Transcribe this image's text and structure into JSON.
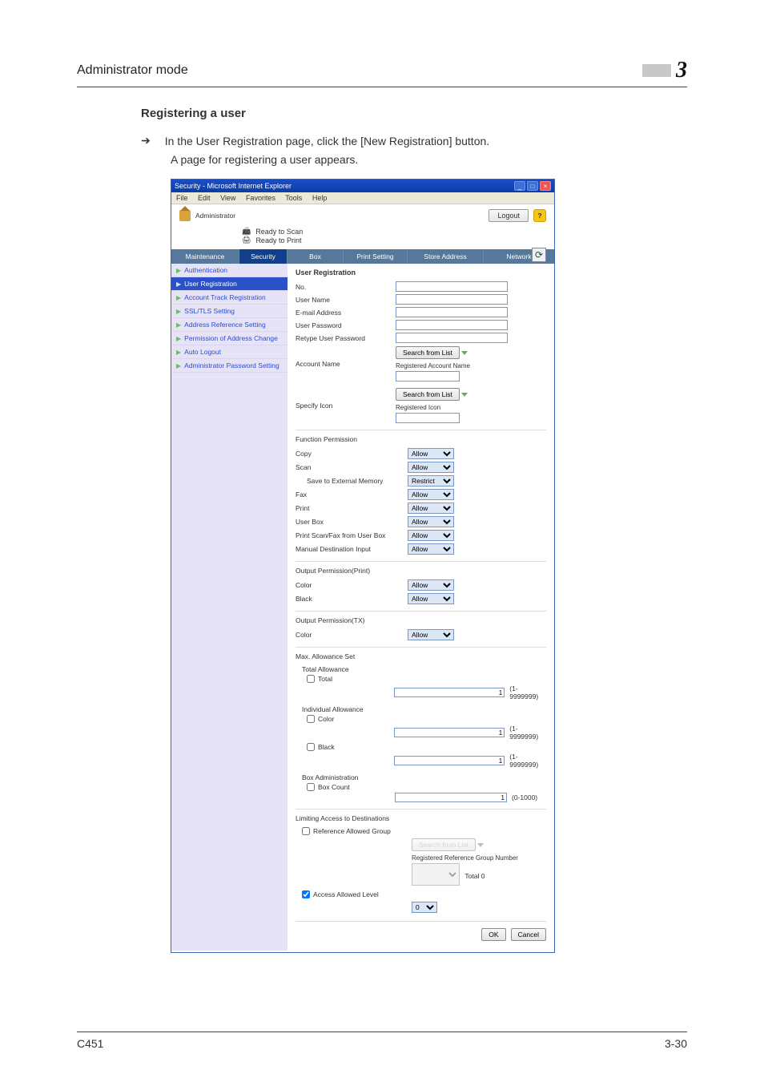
{
  "header": {
    "title": "Administrator mode",
    "chapter": "3"
  },
  "section": {
    "heading": "Registering a user",
    "step": "In the User Registration page, click the [New Registration] button.",
    "note": "A page for registering a user appears."
  },
  "ie": {
    "title": "Security - Microsoft Internet Explorer",
    "menu": {
      "file": "File",
      "edit": "Edit",
      "view": "View",
      "favorites": "Favorites",
      "tools": "Tools",
      "help": "Help"
    }
  },
  "app": {
    "role": "Administrator",
    "logout": "Logout",
    "status_scan": "Ready to Scan",
    "status_print": "Ready to Print",
    "tabs": {
      "maintenance": "Maintenance",
      "security": "Security",
      "box": "Box",
      "print": "Print Setting",
      "addr": "Store Address",
      "network": "Network"
    }
  },
  "sidebar": {
    "items": [
      {
        "label": "Authentication"
      },
      {
        "label": "User Registration"
      },
      {
        "label": "Account Track Registration"
      },
      {
        "label": "SSL/TLS Setting"
      },
      {
        "label": "Address Reference Setting"
      },
      {
        "label": "Permission of Address Change"
      },
      {
        "label": "Auto Logout"
      },
      {
        "label": "Administrator Password Setting"
      }
    ]
  },
  "form": {
    "title": "User Registration",
    "no": "No.",
    "user_name": "User Name",
    "email": "E-mail Address",
    "password": "User Password",
    "retype": "Retype User Password",
    "account_name": "Account Name",
    "search_btn": "Search from List",
    "registered_account": "Registered Account Name",
    "specify_icon": "Specify Icon",
    "registered_icon": "Registered Icon",
    "function_permission": "Function Permission",
    "perms": {
      "copy": "Copy",
      "scan": "Scan",
      "save_ext": "Save to External Memory",
      "fax": "Fax",
      "print": "Print",
      "userbox": "User Box",
      "printscanfax": "Print Scan/Fax from User Box",
      "manualdest": "Manual Destination Input"
    },
    "allow": "Allow",
    "restrict": "Restrict",
    "output_print": "Output Permission(Print)",
    "color": "Color",
    "black": "Black",
    "output_tx": "Output Permission(TX)",
    "color_tx": "Color",
    "maxset": "Max. Allowance Set",
    "total_allow": "Total Allowance",
    "total": "Total",
    "range_big": "(1-9999999)",
    "indiv_allow": "Individual Allowance",
    "box_admin": "Box Administration",
    "box_count": "Box Count",
    "range_small": "(0-1000)",
    "limiting": "Limiting Access to Destinations",
    "ref_group": "Reference Allowed Group",
    "search_disabled": "Search from List",
    "reg_group_no": "Registered Reference Group Number",
    "total0": "Total 0",
    "access_level": "Access Allowed Level",
    "level0": "0",
    "ok": "OK",
    "cancel": "Cancel",
    "num1": "1"
  },
  "footer": {
    "model": "C451",
    "page": "3-30"
  }
}
